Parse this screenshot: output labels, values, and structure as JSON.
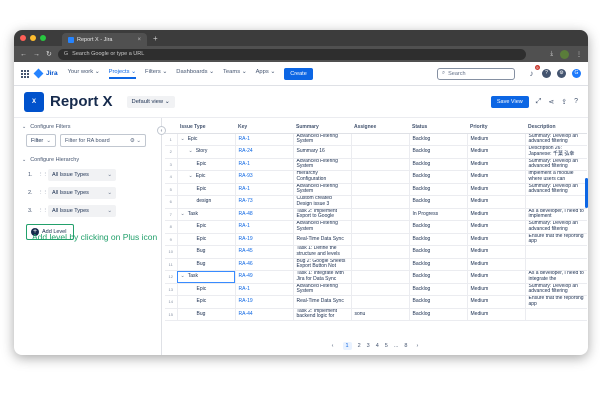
{
  "browser": {
    "tab_title": "Report X - Jira",
    "url_placeholder": "Search Google or type a URL"
  },
  "jira_nav": {
    "product": "Jira",
    "menu": [
      "Your work ⌄",
      "Projects ⌄",
      "Filters ⌄",
      "Dashboards ⌄",
      "Teams ⌄",
      "Apps ⌄"
    ],
    "create_label": "Create",
    "search_placeholder": "Search",
    "notification_count": "9"
  },
  "report": {
    "title": "Report X",
    "view_label": "Default view ⌄",
    "save_view_label": "Save View"
  },
  "left_panel": {
    "configure_filters": "Configure Filters",
    "filter_label": "Filter",
    "filter_board": "Filter for RA board",
    "configure_hierarchy": "Configure Hierarchy",
    "levels": [
      {
        "num": "1.",
        "value": "All Issue Types"
      },
      {
        "num": "2.",
        "value": "All Issue Types"
      },
      {
        "num": "3.",
        "value": "All Issue Types"
      }
    ],
    "add_level_label": "Add Level",
    "hint_text": "Add level by clicking on Plus icon"
  },
  "table": {
    "columns": [
      "Issue Type",
      "Key",
      "Summary",
      "Assignee",
      "Status",
      "Priority",
      "Description"
    ],
    "rows": [
      {
        "num": "1",
        "indent": 0,
        "twisty": "⌄",
        "type": "Epic",
        "key": "RA-1",
        "summary": "Advanced Filtering System",
        "assignee": "",
        "status": "Backlog",
        "priority": "Medium",
        "description": "Summary: Develop an advanced filtering"
      },
      {
        "num": "2",
        "indent": 1,
        "twisty": "⌄",
        "type": "Story",
        "key": "RA-24",
        "summary": "Summary 16",
        "assignee": "",
        "status": "Backlog",
        "priority": "Medium",
        "description": "Description 26: Japanese: 千葉 弘幸"
      },
      {
        "num": "3",
        "indent": 2,
        "twisty": "",
        "type": "Epic",
        "key": "RA-1",
        "summary": "Advanced Filtering System",
        "assignee": "",
        "status": "Backlog",
        "priority": "Medium",
        "description": "Summary: Develop an advanced filtering"
      },
      {
        "num": "4",
        "indent": 1,
        "twisty": "⌄",
        "type": "Epic",
        "key": "RA-93",
        "summary": "Hierarchy Configuration",
        "assignee": "",
        "status": "Backlog",
        "priority": "Medium",
        "description": "implement a module where users can"
      },
      {
        "num": "5",
        "indent": 2,
        "twisty": "",
        "type": "Epic",
        "key": "RA-1",
        "summary": "Advanced Filtering System",
        "assignee": "",
        "status": "Backlog",
        "priority": "Medium",
        "description": "Summary: Develop an advanced filtering"
      },
      {
        "num": "6",
        "indent": 2,
        "twisty": "",
        "type": "design",
        "key": "RA-73",
        "summary": "Custom created Design issue 3",
        "assignee": "",
        "status": "Backlog",
        "priority": "Medium",
        "description": ""
      },
      {
        "num": "7",
        "indent": 0,
        "twisty": "⌄",
        "type": "Task",
        "key": "RA-48",
        "summary": "Task 2: Implement Export to Google",
        "assignee": "",
        "status": "In Progress",
        "priority": "Medium",
        "description": "As a developer, I need to implement"
      },
      {
        "num": "8",
        "indent": 2,
        "twisty": "",
        "type": "Epic",
        "key": "RA-1",
        "summary": "Advanced Filtering System",
        "assignee": "",
        "status": "Backlog",
        "priority": "Medium",
        "description": "Summary: Develop an advanced filtering"
      },
      {
        "num": "9",
        "indent": 2,
        "twisty": "",
        "type": "Epic",
        "key": "RA-19",
        "summary": "Real-Time Data Sync",
        "assignee": "",
        "status": "Backlog",
        "priority": "Medium",
        "description": "Ensure that the reporting app"
      },
      {
        "num": "10",
        "indent": 2,
        "twisty": "",
        "type": "Bug",
        "key": "RA-45",
        "summary": "Task 1: Define the structure and levels",
        "assignee": "",
        "status": "Backlog",
        "priority": "Medium",
        "description": ""
      },
      {
        "num": "11",
        "indent": 2,
        "twisty": "",
        "type": "Bug",
        "key": "RA-46",
        "summary": "Bug 2: Google Sheets Export Button Not",
        "assignee": "",
        "status": "Backlog",
        "priority": "Medium",
        "description": ""
      },
      {
        "num": "12",
        "indent": 0,
        "twisty": "⌄",
        "type": "Task",
        "key": "RA-49",
        "summary": "Task 1: Integrate with Jira for Data Sync",
        "assignee": "",
        "status": "Backlog",
        "priority": "Medium",
        "description": "As a developer, I need to integrate the"
      },
      {
        "num": "13",
        "indent": 2,
        "twisty": "",
        "type": "Epic",
        "key": "RA-1",
        "summary": "Advanced Filtering System",
        "assignee": "",
        "status": "Backlog",
        "priority": "Medium",
        "description": "Summary: Develop an advanced filtering"
      },
      {
        "num": "14",
        "indent": 2,
        "twisty": "",
        "type": "Epic",
        "key": "RA-19",
        "summary": "Real-Time Data Sync",
        "assignee": "",
        "status": "Backlog",
        "priority": "Medium",
        "description": "Ensure that the reporting app"
      },
      {
        "num": "15",
        "indent": 2,
        "twisty": "",
        "type": "Bug",
        "key": "RA-44",
        "summary": "Task 2: Implement backend logic for",
        "assignee": "sonu",
        "status": "Backlog",
        "priority": "Medium",
        "description": ""
      }
    ]
  },
  "pagination": {
    "prev": "‹",
    "pages": [
      "1",
      "2",
      "3",
      "4",
      "5",
      "...",
      "8"
    ],
    "next": "›",
    "current": "1"
  },
  "colors": {
    "brand": "#0c66e4",
    "hint_green": "#22a06b"
  }
}
